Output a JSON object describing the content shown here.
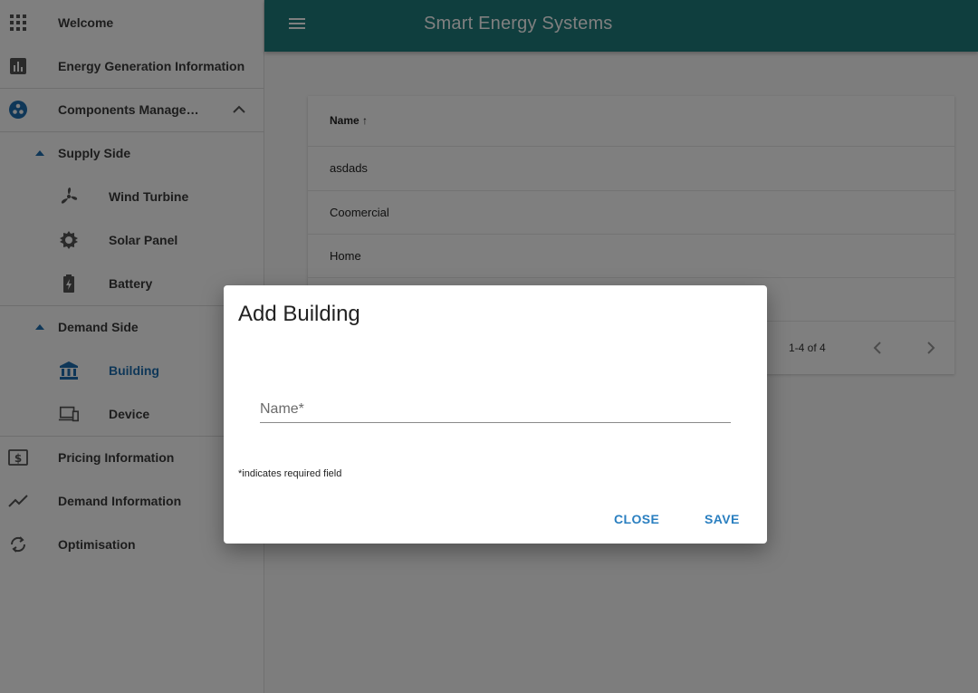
{
  "app": {
    "title": "Smart Energy Systems"
  },
  "sidebar": {
    "items": [
      {
        "label": "Welcome",
        "icon": "apps-grid-icon"
      },
      {
        "label": "Energy Generation Information",
        "icon": "bar-chart-icon"
      },
      {
        "label": "Components Manage…",
        "icon": "components-icon"
      },
      {
        "label": "Supply Side",
        "icon": "caret-up-icon"
      },
      {
        "label": "Wind Turbine",
        "icon": "wind-turbine-icon"
      },
      {
        "label": "Solar Panel",
        "icon": "solar-panel-icon"
      },
      {
        "label": "Battery",
        "icon": "battery-icon"
      },
      {
        "label": "Demand Side",
        "icon": "caret-up-icon"
      },
      {
        "label": "Building",
        "icon": "building-icon"
      },
      {
        "label": "Device",
        "icon": "device-icon"
      },
      {
        "label": "Pricing Information",
        "icon": "pricing-icon"
      },
      {
        "label": "Demand Information",
        "icon": "trend-line-icon"
      },
      {
        "label": "Optimisation",
        "icon": "refresh-icon"
      }
    ]
  },
  "table": {
    "column_header": "Name",
    "sort_indicator": "↑",
    "rows": [
      "asdads",
      "Coomercial",
      "Home",
      ""
    ],
    "pagination": "1-4 of 4"
  },
  "dialog": {
    "title": "Add Building",
    "field_label": "Name*",
    "field_value": "",
    "required_note": "*indicates required field",
    "close_label": "CLOSE",
    "save_label": "SAVE"
  },
  "colors": {
    "appbar": "#1f7c7c",
    "accent": "#2a7fc0",
    "active_nav": "#1e6fb0"
  }
}
